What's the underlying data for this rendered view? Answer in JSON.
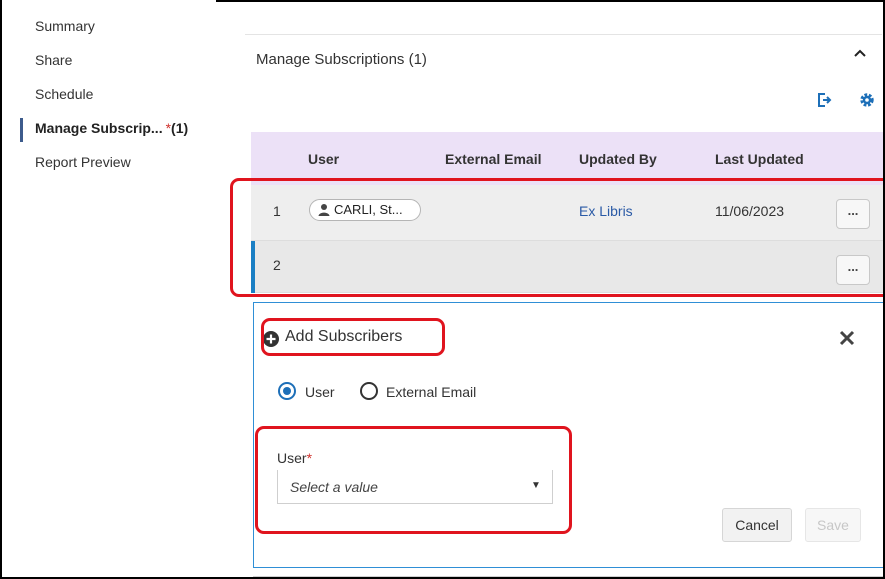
{
  "sidebar": {
    "items": [
      {
        "label": "Summary"
      },
      {
        "label": "Share"
      },
      {
        "label": "Schedule"
      },
      {
        "label": "Manage Subscrip...",
        "required_mark": "*",
        "count": "(1)"
      },
      {
        "label": "Report Preview"
      }
    ]
  },
  "section": {
    "title": "Manage Subscriptions (1)"
  },
  "table": {
    "columns": [
      "User",
      "External Email",
      "Updated By",
      "Last Updated"
    ],
    "rows": [
      {
        "num": "1",
        "user": "CARLI, St...",
        "external_email": "",
        "updated_by": "Ex Libris",
        "last_updated": "11/06/2023",
        "actions": "..."
      },
      {
        "num": "2",
        "user": "",
        "external_email": "",
        "updated_by": "",
        "last_updated": "",
        "actions": "..."
      }
    ]
  },
  "add_panel": {
    "title": "Add Subscribers",
    "radio_options": [
      "User",
      "External Email"
    ],
    "selected_option": "User",
    "field_label": "User",
    "field_required": "*",
    "select_placeholder": "Select a value",
    "cancel_label": "Cancel",
    "save_label": "Save"
  },
  "colors": {
    "accent_blue": "#1d6fb8",
    "header_purple": "#ece1f7",
    "highlight_red": "#e0141e",
    "link_blue": "#2a5aa6"
  },
  "icons": [
    "export-icon",
    "gear-icon",
    "chevron-up-icon",
    "person-icon",
    "plus-circle-icon",
    "close-icon",
    "caret-down-icon"
  ]
}
